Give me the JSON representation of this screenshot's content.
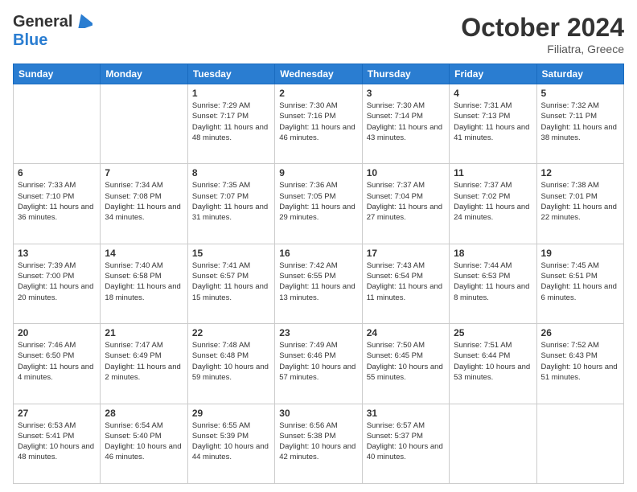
{
  "header": {
    "logo_general": "General",
    "logo_blue": "Blue",
    "month": "October 2024",
    "location": "Filiatra, Greece"
  },
  "weekdays": [
    "Sunday",
    "Monday",
    "Tuesday",
    "Wednesday",
    "Thursday",
    "Friday",
    "Saturday"
  ],
  "weeks": [
    [
      {
        "day": "",
        "sunrise": "",
        "sunset": "",
        "daylight": ""
      },
      {
        "day": "",
        "sunrise": "",
        "sunset": "",
        "daylight": ""
      },
      {
        "day": "1",
        "sunrise": "Sunrise: 7:29 AM",
        "sunset": "Sunset: 7:17 PM",
        "daylight": "Daylight: 11 hours and 48 minutes."
      },
      {
        "day": "2",
        "sunrise": "Sunrise: 7:30 AM",
        "sunset": "Sunset: 7:16 PM",
        "daylight": "Daylight: 11 hours and 46 minutes."
      },
      {
        "day": "3",
        "sunrise": "Sunrise: 7:30 AM",
        "sunset": "Sunset: 7:14 PM",
        "daylight": "Daylight: 11 hours and 43 minutes."
      },
      {
        "day": "4",
        "sunrise": "Sunrise: 7:31 AM",
        "sunset": "Sunset: 7:13 PM",
        "daylight": "Daylight: 11 hours and 41 minutes."
      },
      {
        "day": "5",
        "sunrise": "Sunrise: 7:32 AM",
        "sunset": "Sunset: 7:11 PM",
        "daylight": "Daylight: 11 hours and 38 minutes."
      }
    ],
    [
      {
        "day": "6",
        "sunrise": "Sunrise: 7:33 AM",
        "sunset": "Sunset: 7:10 PM",
        "daylight": "Daylight: 11 hours and 36 minutes."
      },
      {
        "day": "7",
        "sunrise": "Sunrise: 7:34 AM",
        "sunset": "Sunset: 7:08 PM",
        "daylight": "Daylight: 11 hours and 34 minutes."
      },
      {
        "day": "8",
        "sunrise": "Sunrise: 7:35 AM",
        "sunset": "Sunset: 7:07 PM",
        "daylight": "Daylight: 11 hours and 31 minutes."
      },
      {
        "day": "9",
        "sunrise": "Sunrise: 7:36 AM",
        "sunset": "Sunset: 7:05 PM",
        "daylight": "Daylight: 11 hours and 29 minutes."
      },
      {
        "day": "10",
        "sunrise": "Sunrise: 7:37 AM",
        "sunset": "Sunset: 7:04 PM",
        "daylight": "Daylight: 11 hours and 27 minutes."
      },
      {
        "day": "11",
        "sunrise": "Sunrise: 7:37 AM",
        "sunset": "Sunset: 7:02 PM",
        "daylight": "Daylight: 11 hours and 24 minutes."
      },
      {
        "day": "12",
        "sunrise": "Sunrise: 7:38 AM",
        "sunset": "Sunset: 7:01 PM",
        "daylight": "Daylight: 11 hours and 22 minutes."
      }
    ],
    [
      {
        "day": "13",
        "sunrise": "Sunrise: 7:39 AM",
        "sunset": "Sunset: 7:00 PM",
        "daylight": "Daylight: 11 hours and 20 minutes."
      },
      {
        "day": "14",
        "sunrise": "Sunrise: 7:40 AM",
        "sunset": "Sunset: 6:58 PM",
        "daylight": "Daylight: 11 hours and 18 minutes."
      },
      {
        "day": "15",
        "sunrise": "Sunrise: 7:41 AM",
        "sunset": "Sunset: 6:57 PM",
        "daylight": "Daylight: 11 hours and 15 minutes."
      },
      {
        "day": "16",
        "sunrise": "Sunrise: 7:42 AM",
        "sunset": "Sunset: 6:55 PM",
        "daylight": "Daylight: 11 hours and 13 minutes."
      },
      {
        "day": "17",
        "sunrise": "Sunrise: 7:43 AM",
        "sunset": "Sunset: 6:54 PM",
        "daylight": "Daylight: 11 hours and 11 minutes."
      },
      {
        "day": "18",
        "sunrise": "Sunrise: 7:44 AM",
        "sunset": "Sunset: 6:53 PM",
        "daylight": "Daylight: 11 hours and 8 minutes."
      },
      {
        "day": "19",
        "sunrise": "Sunrise: 7:45 AM",
        "sunset": "Sunset: 6:51 PM",
        "daylight": "Daylight: 11 hours and 6 minutes."
      }
    ],
    [
      {
        "day": "20",
        "sunrise": "Sunrise: 7:46 AM",
        "sunset": "Sunset: 6:50 PM",
        "daylight": "Daylight: 11 hours and 4 minutes."
      },
      {
        "day": "21",
        "sunrise": "Sunrise: 7:47 AM",
        "sunset": "Sunset: 6:49 PM",
        "daylight": "Daylight: 11 hours and 2 minutes."
      },
      {
        "day": "22",
        "sunrise": "Sunrise: 7:48 AM",
        "sunset": "Sunset: 6:48 PM",
        "daylight": "Daylight: 10 hours and 59 minutes."
      },
      {
        "day": "23",
        "sunrise": "Sunrise: 7:49 AM",
        "sunset": "Sunset: 6:46 PM",
        "daylight": "Daylight: 10 hours and 57 minutes."
      },
      {
        "day": "24",
        "sunrise": "Sunrise: 7:50 AM",
        "sunset": "Sunset: 6:45 PM",
        "daylight": "Daylight: 10 hours and 55 minutes."
      },
      {
        "day": "25",
        "sunrise": "Sunrise: 7:51 AM",
        "sunset": "Sunset: 6:44 PM",
        "daylight": "Daylight: 10 hours and 53 minutes."
      },
      {
        "day": "26",
        "sunrise": "Sunrise: 7:52 AM",
        "sunset": "Sunset: 6:43 PM",
        "daylight": "Daylight: 10 hours and 51 minutes."
      }
    ],
    [
      {
        "day": "27",
        "sunrise": "Sunrise: 6:53 AM",
        "sunset": "Sunset: 5:41 PM",
        "daylight": "Daylight: 10 hours and 48 minutes."
      },
      {
        "day": "28",
        "sunrise": "Sunrise: 6:54 AM",
        "sunset": "Sunset: 5:40 PM",
        "daylight": "Daylight: 10 hours and 46 minutes."
      },
      {
        "day": "29",
        "sunrise": "Sunrise: 6:55 AM",
        "sunset": "Sunset: 5:39 PM",
        "daylight": "Daylight: 10 hours and 44 minutes."
      },
      {
        "day": "30",
        "sunrise": "Sunrise: 6:56 AM",
        "sunset": "Sunset: 5:38 PM",
        "daylight": "Daylight: 10 hours and 42 minutes."
      },
      {
        "day": "31",
        "sunrise": "Sunrise: 6:57 AM",
        "sunset": "Sunset: 5:37 PM",
        "daylight": "Daylight: 10 hours and 40 minutes."
      },
      {
        "day": "",
        "sunrise": "",
        "sunset": "",
        "daylight": ""
      },
      {
        "day": "",
        "sunrise": "",
        "sunset": "",
        "daylight": ""
      }
    ]
  ]
}
